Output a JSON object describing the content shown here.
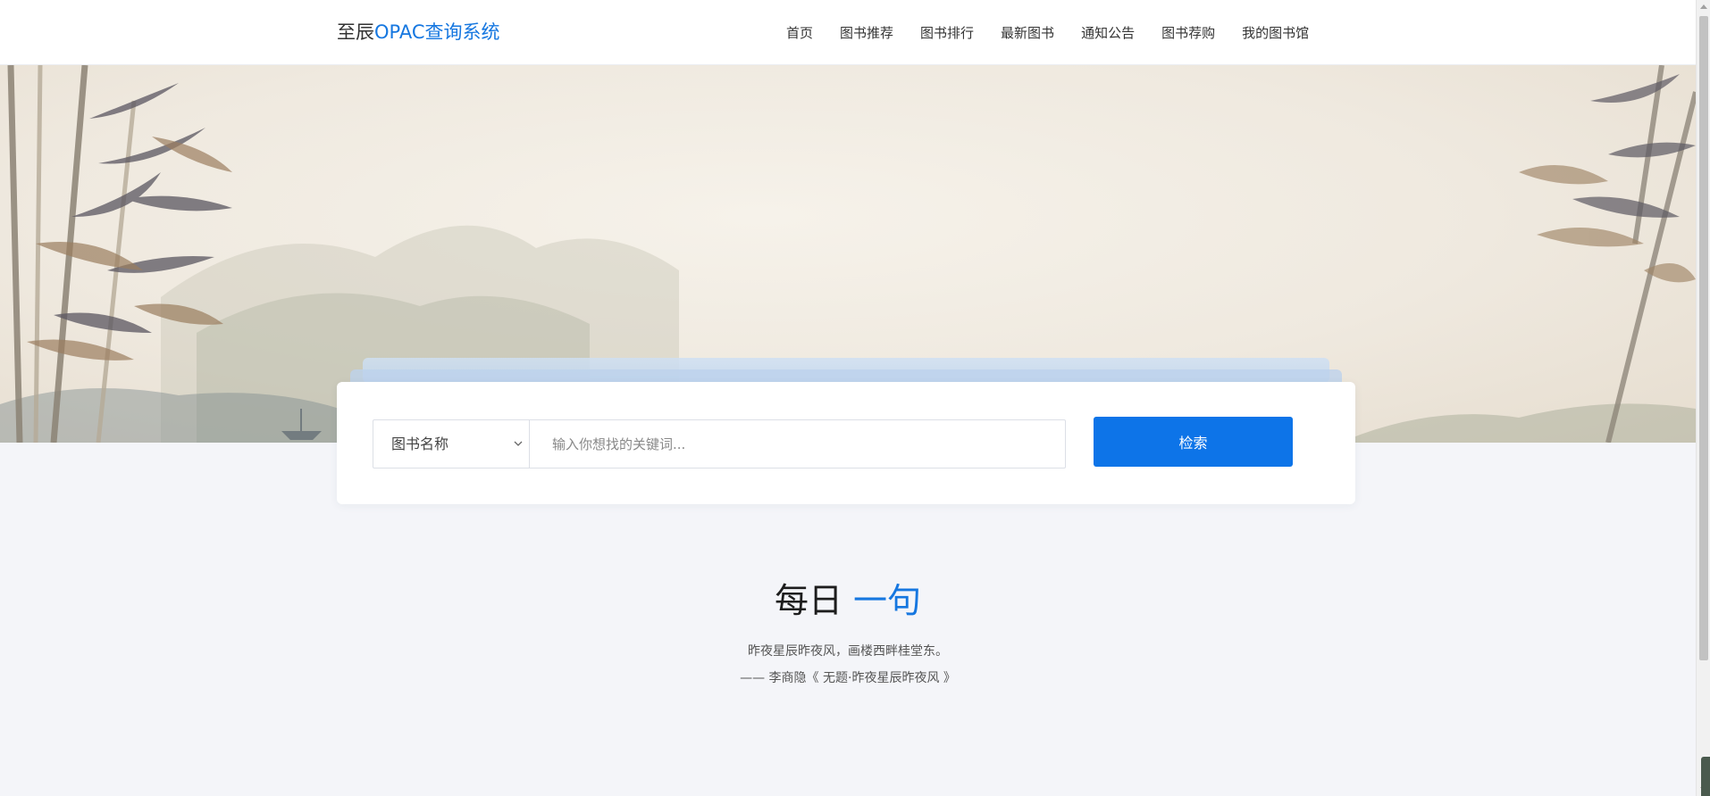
{
  "header": {
    "brand_plain": "至辰",
    "brand_accent": "OPAC查询系统",
    "nav": [
      {
        "label": "首页"
      },
      {
        "label": "图书推荐"
      },
      {
        "label": "图书排行"
      },
      {
        "label": "最新图书"
      },
      {
        "label": "通知公告"
      },
      {
        "label": "图书荐购"
      },
      {
        "label": "我的图书馆"
      }
    ]
  },
  "search": {
    "field_selected": "图书名称",
    "placeholder": "输入你想找的关键词...",
    "button_label": "检索",
    "accent_color": "#0d74e8"
  },
  "daily_quote": {
    "title_plain": "每日",
    "title_accent": "一句",
    "text": "昨夜星辰昨夜风，画楼西畔桂堂东。",
    "source": "—— 李商隐《 无题·昨夜星辰昨夜风 》"
  },
  "icons": {
    "select_arrow": "chevron-down-icon",
    "hero_art": "bamboo-landscape-illustration"
  },
  "colors": {
    "brand_accent": "#1677e0",
    "page_background": "#f4f5f9"
  }
}
